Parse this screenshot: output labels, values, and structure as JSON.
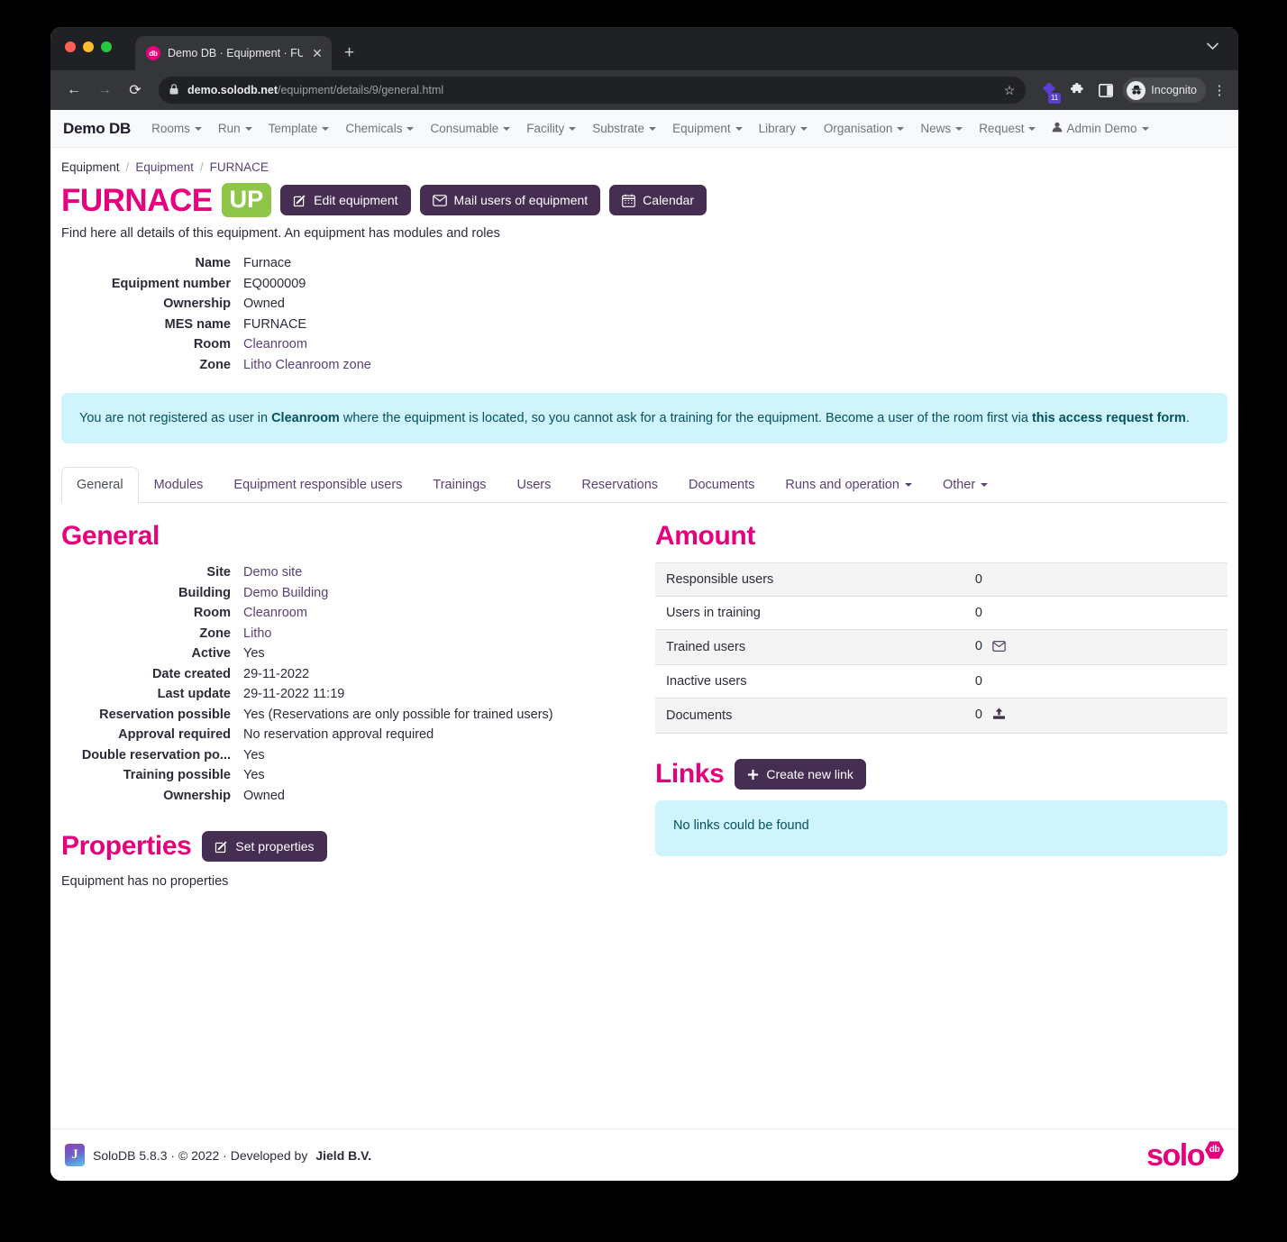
{
  "browser": {
    "tab": {
      "title": "Demo DB · Equipment · FURNA",
      "favicon_label": "db",
      "close_label": "✕"
    },
    "new_tab_label": "+",
    "back_icon": "←",
    "forward_icon": "→",
    "reload_icon": "⟳",
    "url_host": "demo.solodb.net",
    "url_path": "/equipment/details/9/general.html",
    "lock_icon": "🔒",
    "star_icon": "☆",
    "extension_badge_count": "11",
    "profile_label": "Incognito",
    "menu_icon": "⋮"
  },
  "navbar": {
    "brand": "Demo DB",
    "items": [
      {
        "label": "Rooms",
        "caret": true
      },
      {
        "label": "Run",
        "caret": true
      },
      {
        "label": "Template",
        "caret": true
      },
      {
        "label": "Chemicals",
        "caret": true
      },
      {
        "label": "Consumable",
        "caret": true
      },
      {
        "label": "Facility",
        "caret": true
      },
      {
        "label": "Substrate",
        "caret": true
      },
      {
        "label": "Equipment",
        "caret": true
      },
      {
        "label": "Library",
        "caret": true
      },
      {
        "label": "Organisation",
        "caret": true
      },
      {
        "label": "News",
        "caret": true
      },
      {
        "label": "Request",
        "caret": true
      }
    ],
    "user": "Admin Demo"
  },
  "breadcrumb": {
    "first": "Equipment",
    "second": "Equipment",
    "current": "FURNACE",
    "separator": "/"
  },
  "header": {
    "title": "FURNACE",
    "status_badge": "UP",
    "buttons": [
      {
        "label": "Edit equipment",
        "icon": "edit-icon"
      },
      {
        "label": "Mail users of equipment",
        "icon": "mail-icon"
      },
      {
        "label": "Calendar",
        "icon": "calendar-icon"
      }
    ],
    "lead": "Find here all details of this equipment. An equipment has modules and roles"
  },
  "summary": [
    {
      "label": "Name",
      "value": "Furnace",
      "is_link": false
    },
    {
      "label": "Equipment number",
      "value": "EQ000009",
      "is_link": false
    },
    {
      "label": "Ownership",
      "value": "Owned",
      "is_link": false
    },
    {
      "label": "MES name",
      "value": "FURNACE",
      "is_link": false
    },
    {
      "label": "Room",
      "value": "Cleanroom",
      "is_link": true
    },
    {
      "label": "Zone",
      "value": "Litho Cleanroom zone",
      "is_link": true
    }
  ],
  "alert": {
    "p1": "You are not registered as user in ",
    "b1": "Cleanroom",
    "p2": " where the equipment is located, so you cannot ask for a training for the equipment. Become a user of the room first via ",
    "b2": "this access request form",
    "p3": "."
  },
  "tabs": [
    {
      "label": "General",
      "active": true,
      "caret": false
    },
    {
      "label": "Modules",
      "active": false,
      "caret": false
    },
    {
      "label": "Equipment responsible users",
      "active": false,
      "caret": false
    },
    {
      "label": "Trainings",
      "active": false,
      "caret": false
    },
    {
      "label": "Users",
      "active": false,
      "caret": false
    },
    {
      "label": "Reservations",
      "active": false,
      "caret": false
    },
    {
      "label": "Documents",
      "active": false,
      "caret": false
    },
    {
      "label": "Runs and operation",
      "active": false,
      "caret": true
    },
    {
      "label": "Other",
      "active": false,
      "caret": true
    }
  ],
  "general": {
    "heading": "General",
    "rows": [
      {
        "label": "Site",
        "value": "Demo site",
        "is_link": true
      },
      {
        "label": "Building",
        "value": "Demo Building",
        "is_link": true
      },
      {
        "label": "Room",
        "value": "Cleanroom",
        "is_link": true
      },
      {
        "label": "Zone",
        "value": "Litho",
        "is_link": true
      },
      {
        "label": "Active",
        "value": "Yes",
        "is_link": false
      },
      {
        "label": "Date created",
        "value": "29-11-2022",
        "is_link": false
      },
      {
        "label": "Last update",
        "value": "29-11-2022 11:19",
        "is_link": false
      },
      {
        "label": "Reservation possible",
        "value": "Yes (Reservations are only possible for trained users)",
        "is_link": false
      },
      {
        "label": "Approval required",
        "value": "No reservation approval required",
        "is_link": false
      },
      {
        "label": "Double reservation po...",
        "value": "Yes",
        "is_link": false
      },
      {
        "label": "Training possible",
        "value": "Yes",
        "is_link": false
      },
      {
        "label": "Ownership",
        "value": "Owned",
        "is_link": false
      }
    ]
  },
  "properties": {
    "heading": "Properties",
    "button_label": "Set properties",
    "empty_text": "Equipment has no properties"
  },
  "amount": {
    "heading": "Amount",
    "rows": [
      {
        "label": "Responsible users",
        "value": "0",
        "icon": null
      },
      {
        "label": "Users in training",
        "value": "0",
        "icon": null
      },
      {
        "label": "Trained users",
        "value": "0",
        "icon": "mail-icon"
      },
      {
        "label": "Inactive users",
        "value": "0",
        "icon": null
      },
      {
        "label": "Documents",
        "value": "0",
        "icon": "upload-icon"
      }
    ]
  },
  "links": {
    "heading": "Links",
    "button_label": "Create new link",
    "empty_text": "No links could be found"
  },
  "footer": {
    "text": "SoloDB 5.8.3 · © 2022 · Developed by ",
    "company": "Jield B.V.",
    "logo_word": "solo",
    "logo_badge": "db",
    "jield_mark": "J"
  },
  "colors": {
    "brand_pink": "#e6007e",
    "button_purple": "#452e51",
    "link_purple": "#5b4177",
    "badge_green": "#8fc64a",
    "info_bg": "#cff4fc",
    "info_fg": "#055160"
  }
}
